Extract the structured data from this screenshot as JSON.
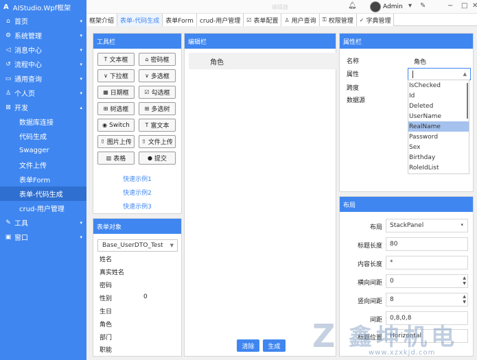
{
  "app": {
    "brand_icon": "A",
    "title": "AIStudio.Wpf框架",
    "window_caption": "编辑器"
  },
  "sidebar": {
    "items": [
      {
        "icon": "⌂",
        "label": "首页",
        "caret": "▾"
      },
      {
        "icon": "⚙",
        "label": "系统管理",
        "caret": "▾"
      },
      {
        "icon": "◁",
        "label": "消息中心",
        "caret": "▾"
      },
      {
        "icon": "↺",
        "label": "流程中心",
        "caret": "▾"
      },
      {
        "icon": "▭",
        "label": "通用查询",
        "caret": "▾"
      },
      {
        "icon": "♙",
        "label": "个人页",
        "caret": "▾"
      },
      {
        "icon": "⊠",
        "label": "开发",
        "caret": "▴"
      }
    ],
    "dev_children": [
      "数据库连接",
      "代码生成",
      "Swagger",
      "文件上传",
      "表单Form",
      "表单-代码生成",
      "crud-用户管理"
    ],
    "bottom_items": [
      {
        "icon": "✎",
        "label": "工具",
        "caret": "▾"
      },
      {
        "icon": "▣",
        "label": "窗口",
        "caret": "▾"
      }
    ]
  },
  "header": {
    "user": "Admin"
  },
  "tabs": [
    {
      "icon": "",
      "label": "框架介绍"
    },
    {
      "icon": "",
      "label": "表单-代码生成"
    },
    {
      "icon": "",
      "label": "表单Form"
    },
    {
      "icon": "",
      "label": "crud-用户管理"
    },
    {
      "icon": "☑",
      "label": "表单配置"
    },
    {
      "icon": "♙",
      "label": "用户查询"
    },
    {
      "icon": "⚿",
      "label": "权限管理"
    },
    {
      "icon": "✓",
      "label": "字典管理"
    }
  ],
  "toolbox": {
    "title": "工具栏",
    "buttons": [
      {
        "icon": "T",
        "label": "文本框"
      },
      {
        "icon": "⌂",
        "label": "密码框"
      },
      {
        "icon": "∨",
        "label": "下拉框"
      },
      {
        "icon": "∨",
        "label": "多选框"
      },
      {
        "icon": "▦",
        "label": "日期框"
      },
      {
        "icon": "☑",
        "label": "勾选框"
      },
      {
        "icon": "⊞",
        "label": "树选框"
      },
      {
        "icon": "⊞",
        "label": "多选树"
      },
      {
        "icon": "◉",
        "label": "Switch"
      },
      {
        "icon": "T",
        "label": "富文本"
      },
      {
        "icon": "⇧",
        "label": "图片上传"
      },
      {
        "icon": "⇧",
        "label": "文件上传"
      },
      {
        "icon": "▥",
        "label": "表格"
      },
      {
        "icon": "●",
        "label": "提交"
      }
    ],
    "links": [
      "快速示例1",
      "快速示例2",
      "快速示例3"
    ]
  },
  "form_object": {
    "title": "表单对象",
    "selected": "Base_UserDTO_Test",
    "fields": [
      "姓名",
      "真实姓名",
      "密码",
      "性别",
      "生日",
      "角色",
      "部门",
      "职能"
    ],
    "gender_value": "0"
  },
  "editor": {
    "title": "编辑栏",
    "item": "角色",
    "clear_label": "清除",
    "generate_label": "生成"
  },
  "properties": {
    "title": "属性栏",
    "name_label": "名称",
    "name_value": "角色",
    "attr_label": "属性",
    "span_label": "跨度",
    "source_label": "数据源",
    "dropdown": [
      "IsChecked",
      "Id",
      "Deleted",
      "UserName",
      "RealName",
      "Password",
      "Sex",
      "Birthday",
      "RoleIdList"
    ],
    "highlighted": "RealName"
  },
  "layout": {
    "title": "布局",
    "rows": [
      {
        "label": "布局",
        "value": "StackPanel"
      },
      {
        "label": "标题长度",
        "value": "80"
      },
      {
        "label": "内容长度",
        "value": "*"
      },
      {
        "label": "横向间距",
        "value": "0"
      },
      {
        "label": "竖向间距",
        "value": "8"
      },
      {
        "label": "间距",
        "value": "0,8,0,8"
      },
      {
        "label": "标题位置",
        "value": "Horizontal"
      }
    ]
  },
  "watermark": {
    "logo": "Z",
    "text": "鑫坤机电",
    "url": "www.xzxkjd.com"
  }
}
